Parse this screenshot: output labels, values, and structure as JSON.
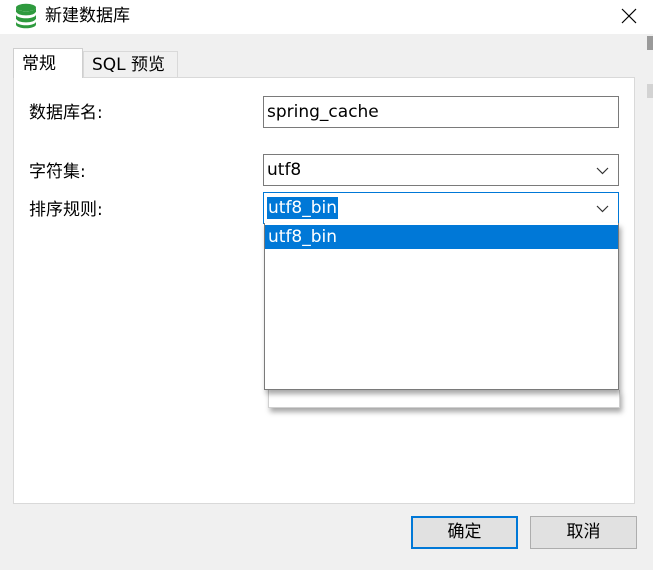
{
  "window": {
    "title": "新建数据库",
    "icon": "database-icon",
    "close_icon": "close-icon"
  },
  "tabs": [
    {
      "label": "常规",
      "active": true
    },
    {
      "label": "SQL 预览",
      "active": false
    }
  ],
  "form": {
    "name_label": "数据库名:",
    "name_value": "spring_cache",
    "charset_label": "字符集:",
    "charset_value": "utf8",
    "collation_label": "排序规则:",
    "collation_value": "utf8_bin",
    "collation_options": [
      "utf8_bin"
    ]
  },
  "buttons": {
    "ok": "确定",
    "cancel": "取消"
  },
  "colors": {
    "accent": "#0078d7",
    "dialog_bg": "#f0f0f0",
    "icon_green": "#2e9a3e"
  }
}
